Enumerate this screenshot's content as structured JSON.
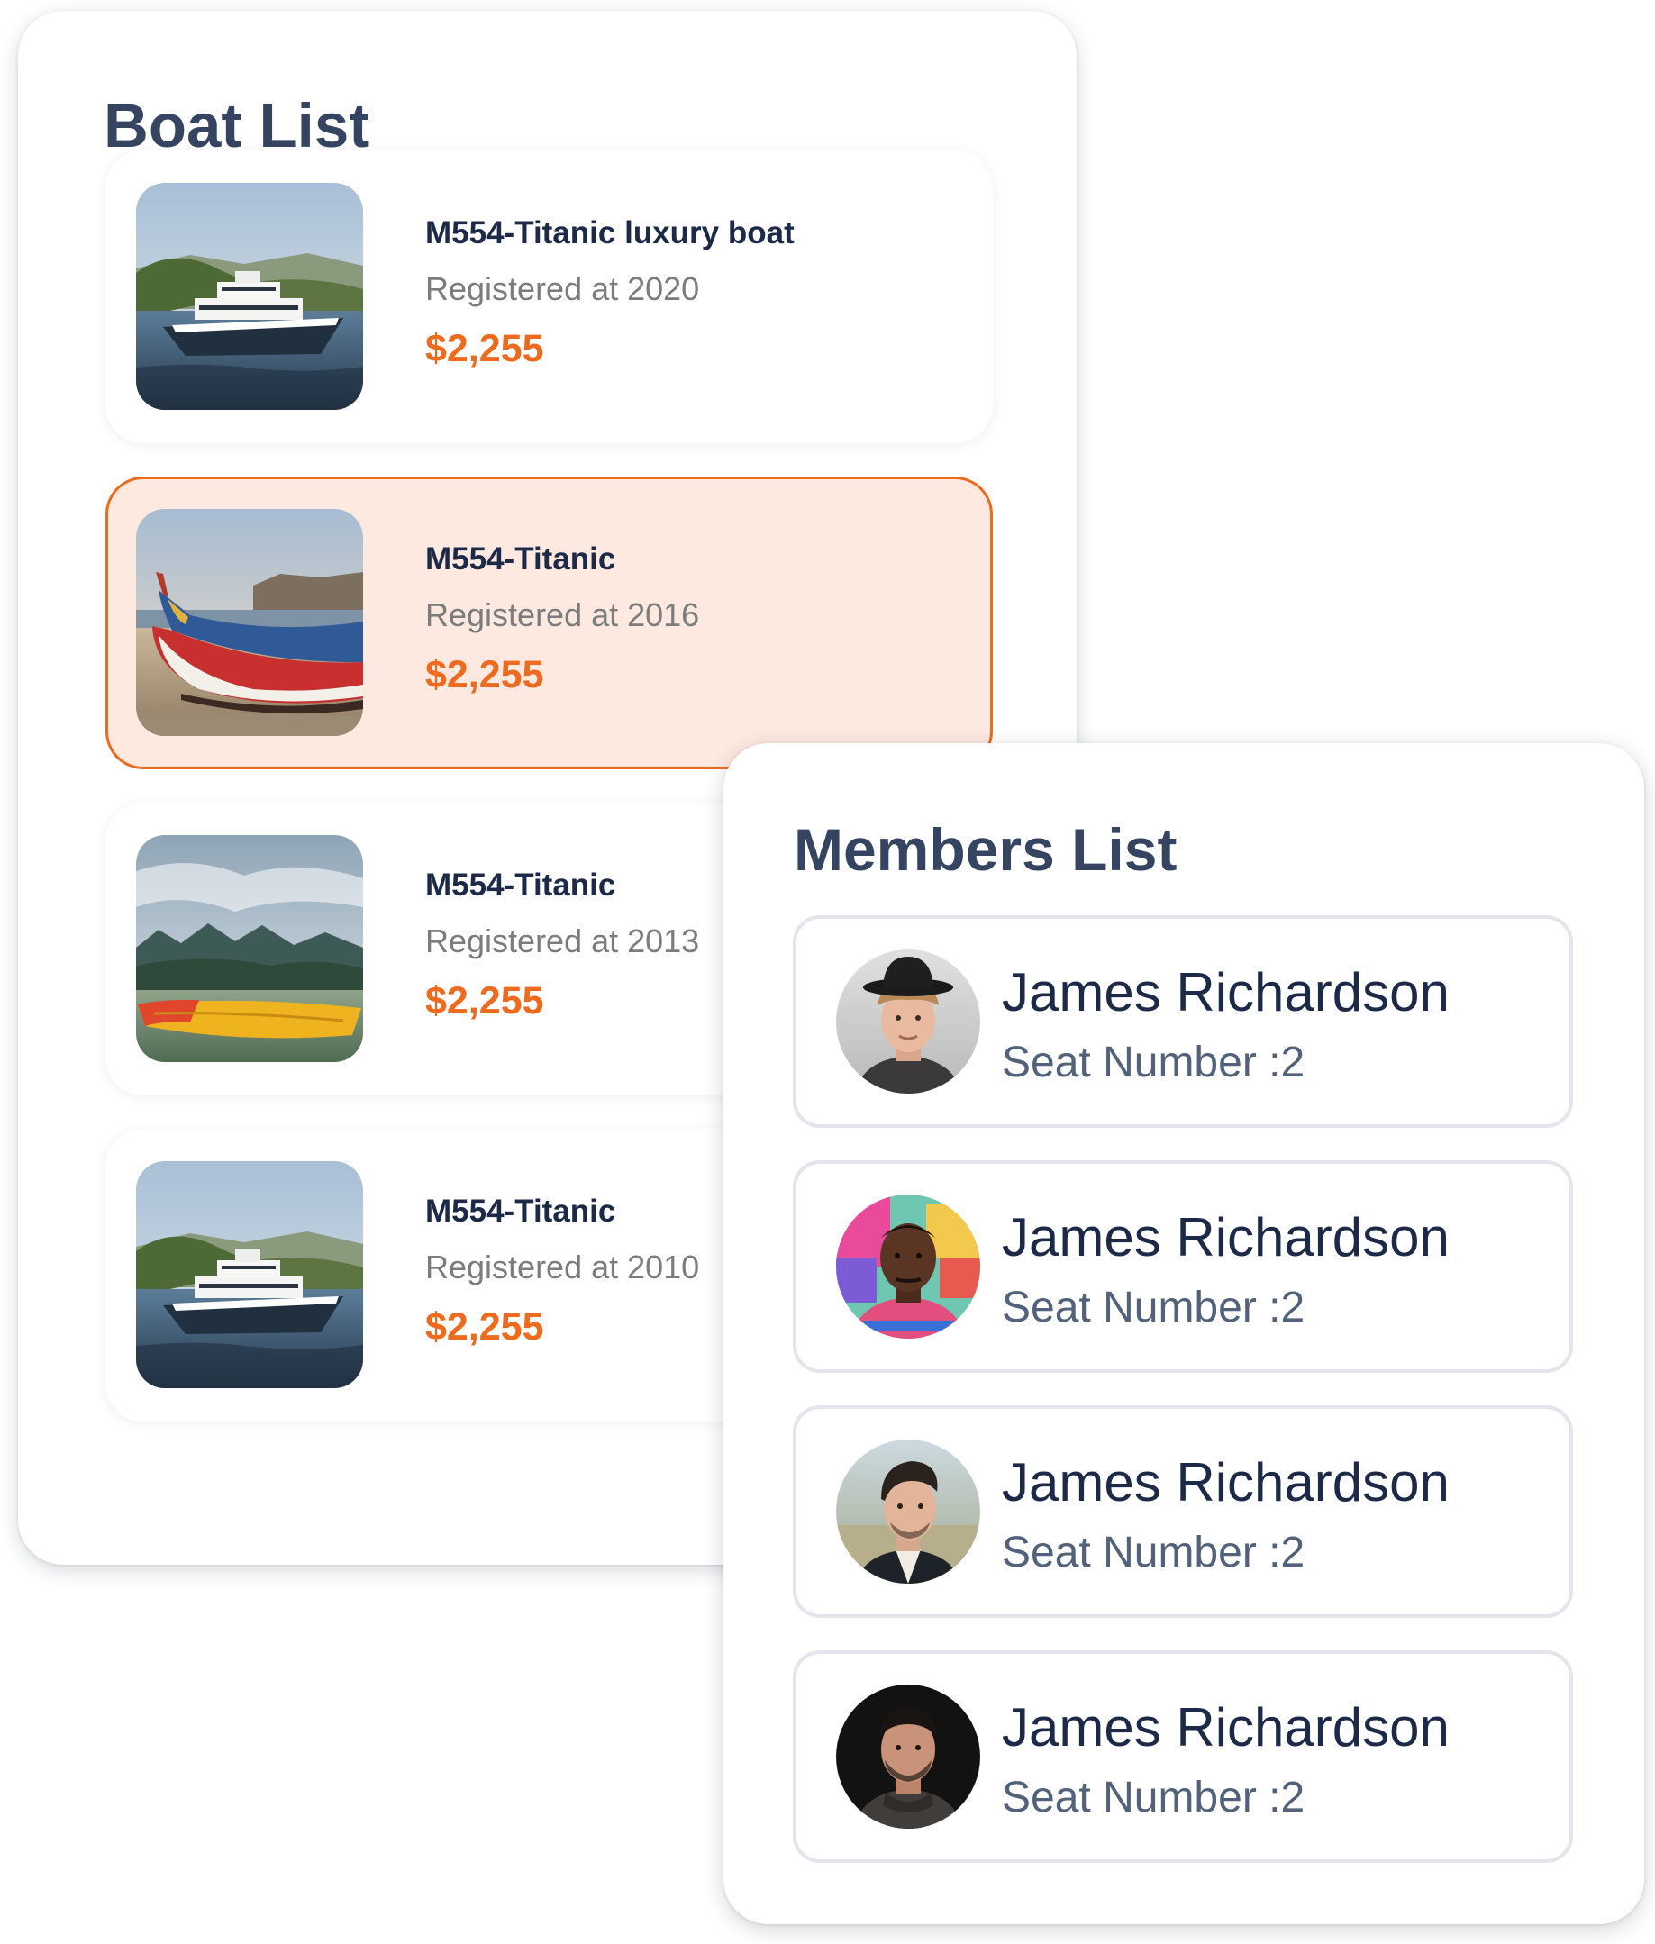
{
  "boat_list": {
    "title": "Boat List",
    "items": [
      {
        "name": "M554-Titanic luxury boat",
        "registered": "Registered at 2020",
        "price": "$2,255",
        "selected": false,
        "image": "white-yacht-photo"
      },
      {
        "name": "M554-Titanic",
        "registered": "Registered at 2016",
        "price": "$2,255",
        "selected": true,
        "image": "wooden-fishing-boat-photo"
      },
      {
        "name": "M554-Titanic",
        "registered": "Registered at 2013",
        "price": "$2,255",
        "selected": false,
        "image": "kayak-on-lake-photo"
      },
      {
        "name": "M554-Titanic",
        "registered": "Registered at 2010",
        "price": "$2,255",
        "selected": false,
        "image": "white-yacht-photo"
      }
    ]
  },
  "members_list": {
    "title": "Members List",
    "items": [
      {
        "name": "James Richardson",
        "seat": "Seat Number :2",
        "avatar": "member-with-hat-photo"
      },
      {
        "name": "James Richardson",
        "seat": "Seat Number :2",
        "avatar": "member-colorful-shirt-photo"
      },
      {
        "name": "James Richardson",
        "seat": "Seat Number :2",
        "avatar": "member-outdoor-photo"
      },
      {
        "name": "James Richardson",
        "seat": "Seat Number :2",
        "avatar": "member-dark-background-photo"
      }
    ]
  },
  "colors": {
    "title": "#354561",
    "name": "#1c2a48",
    "accent": "#ee6a1f",
    "selected_background": "#fde9df",
    "muted_text": "#7c7c7c"
  }
}
